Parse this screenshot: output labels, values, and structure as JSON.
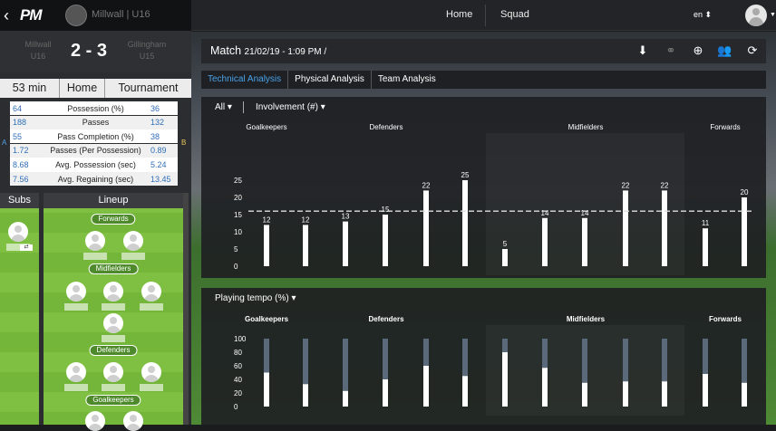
{
  "topbar": {
    "back_icon": "‹",
    "logo": "PM",
    "team_name": "Millwall | U16"
  },
  "score": {
    "team_a": "Millwall U16",
    "team_b": "Gillingham U15",
    "score": "2 - 3"
  },
  "info": {
    "minutes": "53 min",
    "venue": "Home",
    "competition": "Tournament"
  },
  "stats": [
    {
      "a": "64",
      "label": "Possession (%)",
      "b": "36"
    },
    {
      "a": "188",
      "label": "Passes",
      "b": "132"
    },
    {
      "a": "55",
      "label": "Pass Completion (%)",
      "b": "38"
    },
    {
      "a": "1.72",
      "label": "Passes (Per Possession)",
      "b": "0.89"
    },
    {
      "a": "8.68",
      "label": "Avg. Possession (sec)",
      "b": "5.24"
    },
    {
      "a": "7.56",
      "label": "Avg. Regaining (sec)",
      "b": "13.45"
    }
  ],
  "side_labels": {
    "a": "A",
    "b": "B"
  },
  "subs_title": "Subs",
  "lineup": {
    "title": "Lineup",
    "forwards": "Forwards",
    "midfielders": "Midfielders",
    "defenders": "Defenders",
    "goalkeepers": "Goalkeepers"
  },
  "nav": {
    "home": "Home",
    "squad": "Squad",
    "lang": "en"
  },
  "match": {
    "title": "Match",
    "date": "21/02/19 - 1:09 PM /"
  },
  "tabs": [
    "Technical Analysis",
    "Physical Analysis",
    "Team Analysis"
  ],
  "filters": {
    "all": "All",
    "involvement": "Involvement (#)",
    "tempo": "Playing tempo (%)"
  },
  "colors": {
    "accent": "#4aa3ea",
    "bar": "#ffffff",
    "tempo_top": "#5a6a7a"
  },
  "chart_data": [
    {
      "type": "bar",
      "title": "Involvement (#)",
      "groups": [
        "Goalkeepers",
        "Defenders",
        "Midfielders",
        "Forwards"
      ],
      "values": [
        12,
        12,
        13,
        15,
        22,
        25,
        5,
        14,
        14,
        22,
        22,
        11,
        20
      ],
      "group_of": [
        0,
        0,
        1,
        1,
        1,
        1,
        2,
        2,
        2,
        2,
        2,
        3,
        3
      ],
      "ylim": [
        0,
        25
      ],
      "yticks": [
        0,
        5,
        10,
        15,
        20,
        25
      ],
      "average_line": 16,
      "grid": false
    },
    {
      "type": "bar",
      "title": "Playing tempo (%)",
      "groups": [
        "Goalkeepers",
        "Defenders",
        "Midfielders",
        "Forwards"
      ],
      "values": [
        50,
        33,
        23,
        40,
        60,
        45,
        80,
        57,
        35,
        37,
        37,
        48,
        35
      ],
      "group_of": [
        0,
        0,
        1,
        1,
        1,
        1,
        2,
        2,
        2,
        2,
        2,
        3,
        3
      ],
      "ylim": [
        0,
        100
      ],
      "yticks": [
        0,
        20,
        40,
        60,
        80,
        100
      ],
      "grid": false
    }
  ]
}
